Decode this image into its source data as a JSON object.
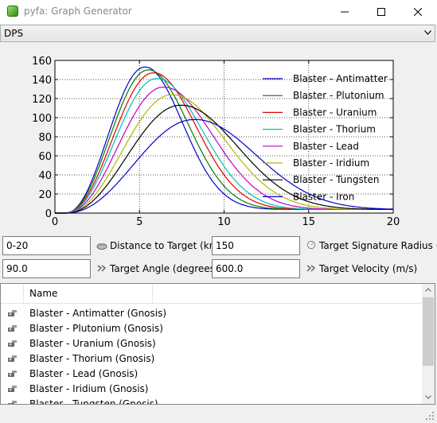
{
  "window": {
    "title": "pyfa: Graph Generator"
  },
  "view_select": {
    "value": "DPS"
  },
  "chart_data": {
    "type": "line",
    "title": "",
    "xlabel": "",
    "ylabel": "",
    "xlim": [
      0,
      20
    ],
    "ylim": [
      0,
      160
    ],
    "x_ticks": [
      "0",
      "5",
      "10",
      "15",
      "20"
    ],
    "y_ticks": [
      "0",
      "20",
      "40",
      "60",
      "80",
      "100",
      "120",
      "140",
      "160"
    ],
    "grid": true,
    "legend_position": "top-right",
    "x": [
      0,
      0.5,
      1,
      1.5,
      2,
      2.5,
      3,
      3.5,
      4,
      4.5,
      5,
      5.5,
      6,
      6.5,
      7,
      7.5,
      8,
      8.5,
      9,
      9.5,
      10,
      11,
      12,
      13,
      14,
      15,
      16,
      17,
      18,
      19,
      20
    ],
    "series": [
      {
        "name": "Blaster - Antimatter",
        "color": "#0000cc",
        "peak_x": 5.3,
        "peak_y": 153,
        "width": 2.15,
        "tail": 3.0
      },
      {
        "name": "Blaster - Plutonium",
        "color": "#007a00",
        "peak_x": 5.5,
        "peak_y": 150,
        "width": 2.25,
        "tail": 3.2
      },
      {
        "name": "Blaster - Uranium",
        "color": "#e00000",
        "peak_x": 5.8,
        "peak_y": 147,
        "width": 2.35,
        "tail": 3.4
      },
      {
        "name": "Blaster - Thorium",
        "color": "#00c0c0",
        "peak_x": 6.0,
        "peak_y": 141,
        "width": 2.45,
        "tail": 3.6
      },
      {
        "name": "Blaster - Lead",
        "color": "#c000c0",
        "peak_x": 6.4,
        "peak_y": 132,
        "width": 2.6,
        "tail": 3.9
      },
      {
        "name": "Blaster - Iridium",
        "color": "#b5b500",
        "peak_x": 6.9,
        "peak_y": 124,
        "width": 2.75,
        "tail": 4.2
      },
      {
        "name": "Blaster - Tungsten",
        "color": "#000000",
        "peak_x": 7.4,
        "peak_y": 113,
        "width": 2.95,
        "tail": 4.5
      },
      {
        "name": "Blaster - Iron",
        "color": "#0000cc",
        "peak_x": 8.2,
        "peak_y": 98,
        "width": 3.2,
        "tail": 4.9
      }
    ]
  },
  "controls": {
    "distance": {
      "value": "0-20",
      "label": "Distance to Target (km)"
    },
    "signature": {
      "value": "150",
      "label": "Target Signature Radius (m)"
    },
    "angle": {
      "value": "90.0",
      "label": "Target Angle (degrees)"
    },
    "velocity": {
      "value": "600.0",
      "label": "Target Velocity (m/s)"
    }
  },
  "list": {
    "header": "Name",
    "items": [
      "Blaster - Antimatter (Gnosis)",
      "Blaster - Plutonium (Gnosis)",
      "Blaster - Uranium (Gnosis)",
      "Blaster - Thorium (Gnosis)",
      "Blaster - Lead (Gnosis)",
      "Blaster - Iridium (Gnosis)",
      "Blaster - Tungsten (Gnosis)"
    ],
    "item_icon": "turret-icon"
  }
}
